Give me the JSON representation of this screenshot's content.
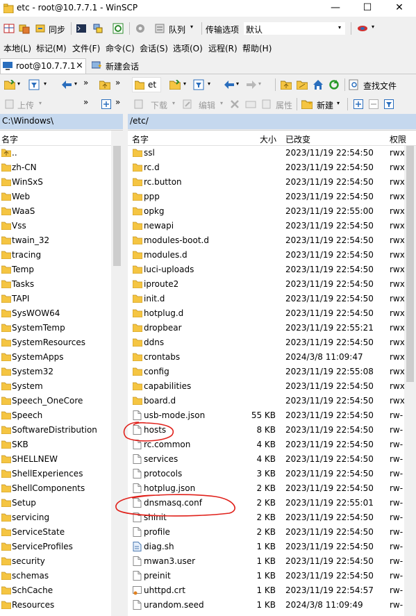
{
  "window": {
    "title": "etc - root@10.7.7.1 - WinSCP",
    "buttons": {
      "minimize": "—",
      "maximize": "☐",
      "close": "✕"
    }
  },
  "toolbar_main": {
    "sync_label": "同步",
    "queue_label": "队列",
    "transfer_options_label": "传输选项",
    "transfer_preset": "默认"
  },
  "menu": [
    "本地(L)",
    "标记(M)",
    "文件(F)",
    "命令(C)",
    "会话(S)",
    "选项(O)",
    "远程(R)",
    "帮助(H)"
  ],
  "tabs": {
    "session": "root@10.7.7.1",
    "session_close": "×",
    "new_session": "新建会话"
  },
  "local_toolbar": {
    "upload_label": "上传",
    "plus": "+"
  },
  "remote_toolbar": {
    "dir_label": "et",
    "find_label": "查找文件",
    "download_label": "下载",
    "edit_label": "编辑",
    "properties_label": "属性",
    "new_label": "新建",
    "plus": "+",
    "minus": "−"
  },
  "local": {
    "path": "C:\\Windows\\",
    "col_name": "名字",
    "items": [
      "..",
      "zh-CN",
      "WinSxS",
      "Web",
      "WaaS",
      "Vss",
      "twain_32",
      "tracing",
      "Temp",
      "Tasks",
      "TAPI",
      "SysWOW64",
      "SystemTemp",
      "SystemResources",
      "SystemApps",
      "System32",
      "System",
      "Speech_OneCore",
      "Speech",
      "SoftwareDistribution",
      "SKB",
      "SHELLNEW",
      "ShellExperiences",
      "ShellComponents",
      "Setup",
      "servicing",
      "ServiceState",
      "ServiceProfiles",
      "security",
      "schemas",
      "SchCache",
      "Resources"
    ]
  },
  "remote": {
    "path": "/etc/",
    "columns": {
      "name": "名字",
      "size": "大小",
      "changed": "已改变",
      "rights": "权限"
    },
    "rows": [
      {
        "name": "ssl",
        "size": "",
        "changed": "2023/11/19 22:54:50",
        "rights": "rwx",
        "type": "folder"
      },
      {
        "name": "rc.d",
        "size": "",
        "changed": "2023/11/19 22:54:50",
        "rights": "rwx",
        "type": "folder"
      },
      {
        "name": "rc.button",
        "size": "",
        "changed": "2023/11/19 22:54:50",
        "rights": "rwx",
        "type": "folder"
      },
      {
        "name": "ppp",
        "size": "",
        "changed": "2023/11/19 22:54:50",
        "rights": "rwx",
        "type": "folder"
      },
      {
        "name": "opkg",
        "size": "",
        "changed": "2023/11/19 22:55:00",
        "rights": "rwx",
        "type": "folder"
      },
      {
        "name": "newapi",
        "size": "",
        "changed": "2023/11/19 22:54:50",
        "rights": "rwx",
        "type": "folder"
      },
      {
        "name": "modules-boot.d",
        "size": "",
        "changed": "2023/11/19 22:54:50",
        "rights": "rwx",
        "type": "folder"
      },
      {
        "name": "modules.d",
        "size": "",
        "changed": "2023/11/19 22:54:50",
        "rights": "rwx",
        "type": "folder"
      },
      {
        "name": "luci-uploads",
        "size": "",
        "changed": "2023/11/19 22:54:50",
        "rights": "rwx",
        "type": "folder"
      },
      {
        "name": "iproute2",
        "size": "",
        "changed": "2023/11/19 22:54:50",
        "rights": "rwx",
        "type": "folder"
      },
      {
        "name": "init.d",
        "size": "",
        "changed": "2023/11/19 22:54:50",
        "rights": "rwx",
        "type": "folder"
      },
      {
        "name": "hotplug.d",
        "size": "",
        "changed": "2023/11/19 22:54:50",
        "rights": "rwx",
        "type": "folder"
      },
      {
        "name": "dropbear",
        "size": "",
        "changed": "2023/11/19 22:55:21",
        "rights": "rwx",
        "type": "folder"
      },
      {
        "name": "ddns",
        "size": "",
        "changed": "2023/11/19 22:54:50",
        "rights": "rwx",
        "type": "folder"
      },
      {
        "name": "crontabs",
        "size": "",
        "changed": "2024/3/8 11:09:47",
        "rights": "rwx",
        "type": "folder"
      },
      {
        "name": "config",
        "size": "",
        "changed": "2023/11/19 22:55:08",
        "rights": "rwx",
        "type": "folder"
      },
      {
        "name": "capabilities",
        "size": "",
        "changed": "2023/11/19 22:54:50",
        "rights": "rwx",
        "type": "folder"
      },
      {
        "name": "board.d",
        "size": "",
        "changed": "2023/11/19 22:54:50",
        "rights": "rwx",
        "type": "folder"
      },
      {
        "name": "usb-mode.json",
        "size": "55 KB",
        "changed": "2023/11/19 22:54:50",
        "rights": "rw-",
        "type": "file"
      },
      {
        "name": "hosts",
        "size": "8 KB",
        "changed": "2023/11/19 22:54:50",
        "rights": "rw-",
        "type": "file"
      },
      {
        "name": "rc.common",
        "size": "4 KB",
        "changed": "2023/11/19 22:54:50",
        "rights": "rw-",
        "type": "file"
      },
      {
        "name": "services",
        "size": "4 KB",
        "changed": "2023/11/19 22:54:50",
        "rights": "rw-",
        "type": "file"
      },
      {
        "name": "protocols",
        "size": "3 KB",
        "changed": "2023/11/19 22:54:50",
        "rights": "rw-",
        "type": "file"
      },
      {
        "name": "hotplug.json",
        "size": "2 KB",
        "changed": "2023/11/19 22:54:50",
        "rights": "rw-",
        "type": "file"
      },
      {
        "name": "dnsmasq.conf",
        "size": "2 KB",
        "changed": "2023/11/19 22:55:01",
        "rights": "rw-",
        "type": "file"
      },
      {
        "name": "shinit",
        "size": "2 KB",
        "changed": "2023/11/19 22:54:50",
        "rights": "rw-",
        "type": "file"
      },
      {
        "name": "profile",
        "size": "2 KB",
        "changed": "2023/11/19 22:54:50",
        "rights": "rw-",
        "type": "file"
      },
      {
        "name": "diag.sh",
        "size": "1 KB",
        "changed": "2023/11/19 22:54:50",
        "rights": "rw-",
        "type": "script"
      },
      {
        "name": "mwan3.user",
        "size": "1 KB",
        "changed": "2023/11/19 22:54:50",
        "rights": "rw-",
        "type": "file"
      },
      {
        "name": "preinit",
        "size": "1 KB",
        "changed": "2023/11/19 22:54:50",
        "rights": "rw-",
        "type": "file"
      },
      {
        "name": "uhttpd.crt",
        "size": "1 KB",
        "changed": "2023/11/19 22:54:57",
        "rights": "rw-",
        "type": "cert"
      },
      {
        "name": "urandom.seed",
        "size": "1 KB",
        "changed": "2024/3/8 11:09:49",
        "rights": "rw-",
        "type": "file"
      }
    ]
  },
  "annotations": {
    "circled_items": [
      "hosts",
      "dnsmasq.conf"
    ],
    "color": "#e0201a"
  },
  "colors": {
    "path_bar": "#c5d8ee",
    "folder": "#f5c542",
    "accent": "#2a6ebd"
  }
}
